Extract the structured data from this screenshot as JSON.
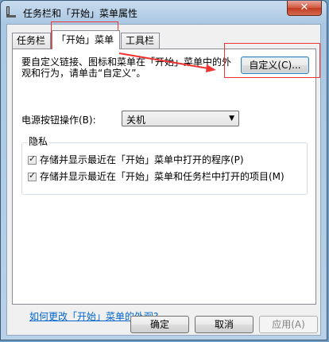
{
  "window": {
    "title": "任务栏和「开始」菜单属性",
    "close_glyph": "✕"
  },
  "tabs": [
    {
      "label": "任务栏"
    },
    {
      "label": "「开始」菜单"
    },
    {
      "label": "工具栏"
    }
  ],
  "start_menu": {
    "description": "要自定义链接、图标和菜单在「开始」菜单中的外观和行为，请单击“自定义”。",
    "customize_label": "自定义(C)...",
    "power_label": "电源按钮操作(B):",
    "power_value": "关机",
    "privacy": {
      "title": "隐私",
      "options": [
        {
          "label": "存储并显示最近在「开始」菜单中打开的程序(P)",
          "checked": true
        },
        {
          "label": "存储并显示最近在「开始」菜单和任务栏中打开的项目(M)",
          "checked": true
        }
      ]
    },
    "help_link": "如何更改「开始」菜单的外观?"
  },
  "footer": {
    "ok": "确定",
    "cancel": "取消",
    "apply": "应用(A)"
  },
  "annotation_color": "#e33333"
}
